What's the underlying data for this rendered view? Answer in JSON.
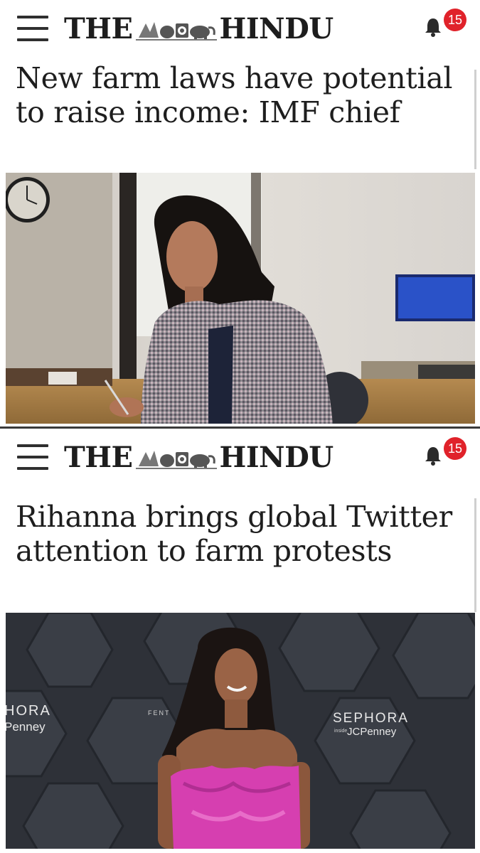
{
  "app": {
    "masthead_left": "THE",
    "masthead_right": "HINDU",
    "notification_count": "15"
  },
  "articles": [
    {
      "headline": "New farm laws have potential to raise income: IMF chief"
    },
    {
      "headline": "Rihanna brings global Twitter attention to farm protests",
      "photo_backdrop_text": {
        "left_line1": "HORA",
        "left_line2": "Penney",
        "center": "FENT",
        "right_line1": "SEPHORA",
        "right_small": "inside",
        "right_line2": "JCPenney"
      }
    }
  ],
  "colors": {
    "badge": "#e0222a",
    "text": "#1e1e1e",
    "dress": "#d63fb0",
    "divider": "#3a3a3a"
  },
  "icons": [
    "menu-icon",
    "bell-icon",
    "masthead-emblem"
  ]
}
